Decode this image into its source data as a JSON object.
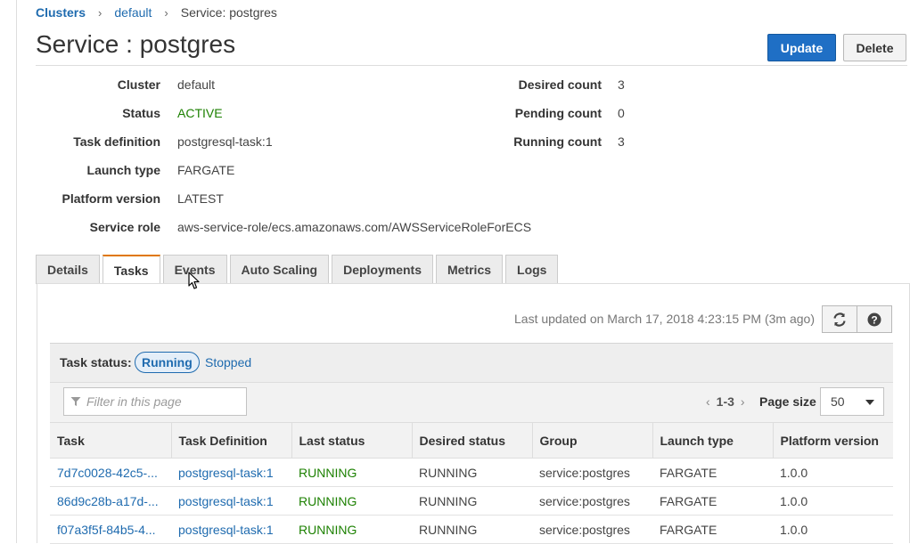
{
  "breadcrumb": {
    "root": "Clusters",
    "parent": "default",
    "current": "Service: postgres"
  },
  "page_title": "Service : postgres",
  "actions": {
    "update": "Update",
    "delete": "Delete"
  },
  "details": {
    "left": [
      {
        "label": "Cluster",
        "value": "default",
        "link": true
      },
      {
        "label": "Status",
        "value": "ACTIVE",
        "status": true
      },
      {
        "label": "Task definition",
        "value": "postgresql-task:1",
        "link": true
      },
      {
        "label": "Launch type",
        "value": "FARGATE"
      },
      {
        "label": "Platform version",
        "value": "LATEST"
      },
      {
        "label": "Service role",
        "value": "aws-service-role/ecs.amazonaws.com/AWSServiceRoleForECS"
      }
    ],
    "right": [
      {
        "label": "Desired count",
        "value": "3"
      },
      {
        "label": "Pending count",
        "value": "0"
      },
      {
        "label": "Running count",
        "value": "3"
      }
    ]
  },
  "tabs": [
    {
      "label": "Details"
    },
    {
      "label": "Tasks",
      "selected": true
    },
    {
      "label": "Events"
    },
    {
      "label": "Auto Scaling"
    },
    {
      "label": "Deployments"
    },
    {
      "label": "Metrics"
    },
    {
      "label": "Logs"
    }
  ],
  "tasks_panel": {
    "last_updated": "Last updated on March 17, 2018 4:23:15 PM (3m ago)",
    "status_label": "Task status:",
    "status_running": "Running",
    "status_stopped": "Stopped",
    "filter_placeholder": "Filter in this page",
    "pager_range": "1-3",
    "page_size_label": "Page size",
    "page_size_value": "50",
    "columns": [
      "Task",
      "Task Definition",
      "Last status",
      "Desired status",
      "Group",
      "Launch type",
      "Platform version"
    ],
    "rows": [
      {
        "task": "7d7c0028-42c5-...",
        "task_definition": "postgresql-task:1",
        "last_status": "RUNNING",
        "desired_status": "RUNNING",
        "group": "service:postgres",
        "launch_type": "FARGATE",
        "platform_version": "1.0.0"
      },
      {
        "task": "86d9c28b-a17d-...",
        "task_definition": "postgresql-task:1",
        "last_status": "RUNNING",
        "desired_status": "RUNNING",
        "group": "service:postgres",
        "launch_type": "FARGATE",
        "platform_version": "1.0.0"
      },
      {
        "task": "f07a3f5f-84b5-4...",
        "task_definition": "postgresql-task:1",
        "last_status": "RUNNING",
        "desired_status": "RUNNING",
        "group": "service:postgres",
        "launch_type": "FARGATE",
        "platform_version": "1.0.0"
      }
    ]
  },
  "icons": {
    "refresh": "refresh-icon",
    "help": "help-icon",
    "filter": "filter-icon",
    "cursor": "mouse-cursor-icon"
  },
  "colors": {
    "link": "#1f6baf",
    "primary_button": "#1f6fc5",
    "status_active": "#1d8102",
    "tab_accent": "#e07700"
  }
}
